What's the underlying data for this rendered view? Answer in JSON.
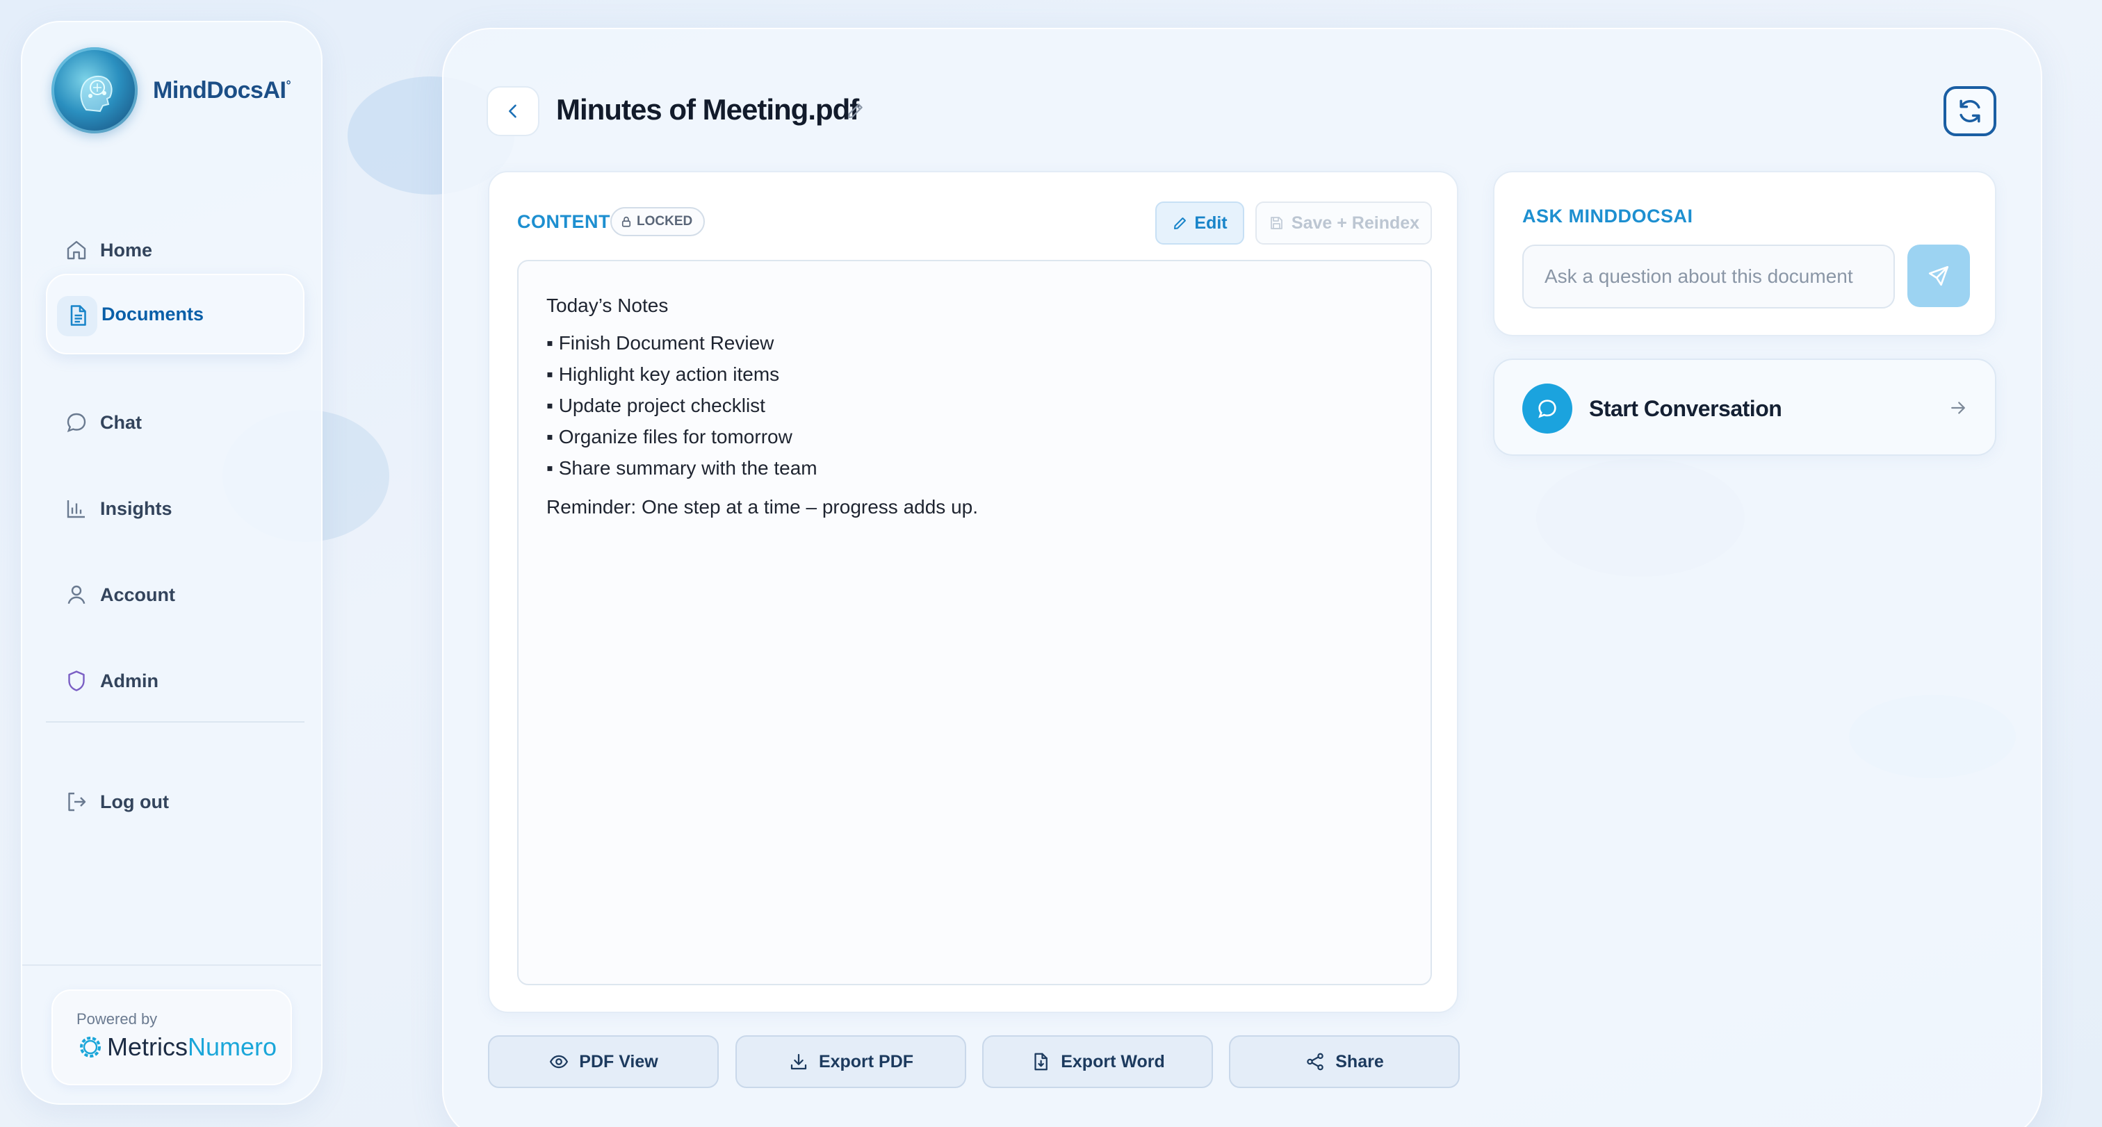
{
  "app": {
    "name": "MindDocsAI",
    "name_mark": "°"
  },
  "sidebar": {
    "items": [
      {
        "label": "Home",
        "icon": "home-icon"
      },
      {
        "label": "Documents",
        "icon": "document-icon",
        "active": true
      },
      {
        "label": "Chat",
        "icon": "chat-icon"
      },
      {
        "label": "Insights",
        "icon": "bar-chart-icon"
      },
      {
        "label": "Account",
        "icon": "user-icon"
      },
      {
        "label": "Admin",
        "icon": "shield-icon"
      }
    ],
    "logout_label": "Log out",
    "powered_by_label": "Powered by",
    "powered_brand_part1": "Metrics",
    "powered_brand_part2": "Numero"
  },
  "header": {
    "document_title": "Minutes of Meeting.pdf"
  },
  "content": {
    "section_label": "CONTENT",
    "locked_label": "LOCKED",
    "edit_label": "Edit",
    "save_label": "Save + Reindex",
    "heading": "Today’s Notes",
    "bullets": [
      "▪ Finish Document Review",
      "▪ Highlight key action items",
      "▪ Update project checklist",
      "▪ Organize files for tomorrow",
      "▪ Share summary with the team"
    ],
    "reminder": "Reminder: One step at a time – progress adds up."
  },
  "actions": {
    "pdf_view": "PDF View",
    "export_pdf": "Export PDF",
    "export_word": "Export Word",
    "share": "Share"
  },
  "ask": {
    "label": "ASK MINDDOCSAI",
    "placeholder": "Ask a question about this document"
  },
  "conversation": {
    "label": "Start Conversation"
  },
  "colors": {
    "accent": "#1d8fd0",
    "brand_dark": "#1b4e86",
    "send_button": "#9cd3f2",
    "chat_bubble": "#1ba3de"
  }
}
